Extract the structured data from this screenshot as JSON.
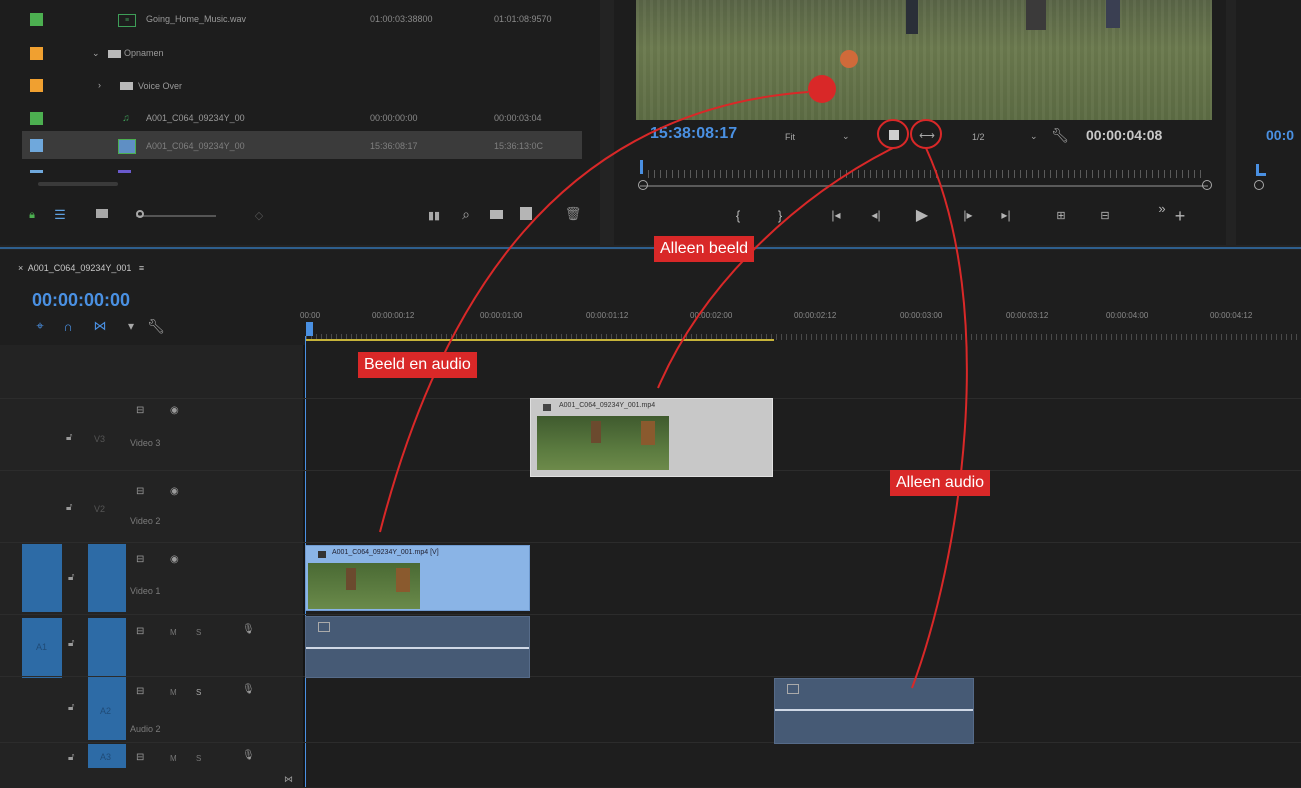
{
  "project": {
    "items": [
      {
        "name": "Going_Home_Music.wav",
        "start": "01:00:03:38800",
        "end": "01:01:08:9570",
        "color": "#4caf50"
      },
      {
        "name": "Opnamen",
        "start": "",
        "end": "",
        "color": "#f0a030"
      },
      {
        "name": "Voice Over",
        "start": "",
        "end": "",
        "color": "#f0a030"
      },
      {
        "name": "A001_C064_09234Y_00",
        "start": "00:00:00:00",
        "end": "00:00:03:04",
        "color": "#4caf50"
      },
      {
        "name": "A001_C064_09234Y_00",
        "start": "15:36:08:17",
        "end": "15:36:13:0C",
        "color": "#6fa8dc"
      }
    ]
  },
  "source": {
    "timecode_in": "15:38:08:17",
    "fit": "Fit",
    "resolution": "1/2",
    "duration": "00:00:04:08",
    "right_timecode": "00:0"
  },
  "timeline": {
    "sequence_name": "A001_C064_09234Y_001",
    "playhead": "00:00:00:00",
    "ruler": [
      "00:00",
      "00:00:00:12",
      "00:00:01:00",
      "00:00:01:12",
      "00:00:02:00",
      "00:00:02:12",
      "00:00:03:00",
      "00:00:03:12",
      "00:00:04:00",
      "00:00:04:12"
    ],
    "tracks": {
      "v3": {
        "label": "V3",
        "name": "Video 3"
      },
      "v2": {
        "label": "V2",
        "name": "Video 2"
      },
      "v1": {
        "label": "V1",
        "name": "Video 1"
      },
      "a1": {
        "label": "A1"
      },
      "a2": {
        "label": "A2",
        "name": "Audio 2"
      },
      "a3": {
        "label": "A3"
      }
    },
    "clips": {
      "v3_clip": "A001_C064_09234Y_001.mp4",
      "v1_clip": "A001_C064_09234Y_001.mp4 [V]"
    },
    "track_buttons": {
      "m": "M",
      "s": "S"
    }
  },
  "callouts": {
    "alleen_beeld": "Alleen beeld",
    "beeld_en_audio": "Beeld en audio",
    "alleen_audio": "Alleen audio"
  },
  "colors": {
    "accent": "#d92828",
    "timecode": "#4a90e2"
  }
}
